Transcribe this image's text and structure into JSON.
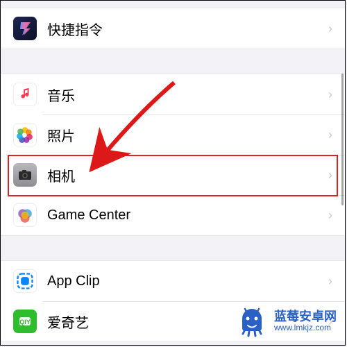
{
  "group1": {
    "items": [
      {
        "label": "快捷指令",
        "icon": "shortcuts-icon"
      }
    ]
  },
  "group2": {
    "items": [
      {
        "label": "音乐",
        "icon": "music-icon"
      },
      {
        "label": "照片",
        "icon": "photos-icon"
      },
      {
        "label": "相机",
        "icon": "camera-icon",
        "highlighted": true
      },
      {
        "label": "Game Center",
        "icon": "gamecenter-icon"
      }
    ]
  },
  "group3": {
    "items": [
      {
        "label": "App Clip",
        "icon": "appclip-icon"
      },
      {
        "label": "爱奇艺",
        "icon": "iqiyi-icon"
      }
    ]
  },
  "watermark": {
    "title": "蓝莓安卓网",
    "url": "www.lmkjz.com"
  },
  "annotation": {
    "arrow_color": "#dd1818",
    "highlight_color": "#dd2222"
  }
}
